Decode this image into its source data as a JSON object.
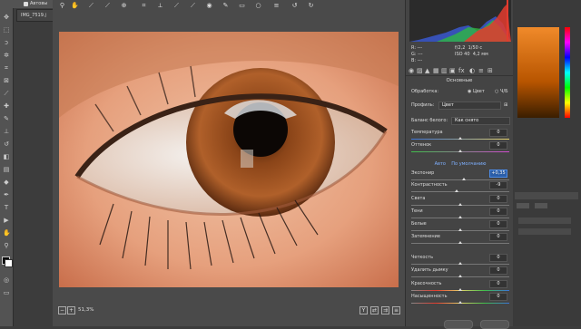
{
  "app": {
    "option_label": "Автовы",
    "doc_tab": "IMG_7519.j"
  },
  "camera_raw": {
    "meta": {
      "r_label": "R:",
      "g_label": "G:",
      "b_label": "B:",
      "dash": "---",
      "aperture": "f/2,2",
      "shutter": "1/50 с",
      "iso": "ISO 40",
      "focal": "4,2 мм"
    },
    "section_title": "Основные",
    "processing_label": "Обработка:",
    "processing_color": "Цвет",
    "processing_bw": "Ч/Б",
    "profile_label": "Профиль:",
    "profile_value": "Цвет",
    "wb_label": "Баланс белого:",
    "wb_value": "Как снято",
    "auto_link": "Авто",
    "default_link": "По умолчанию",
    "zoom_level": "51,3%",
    "sliders": [
      {
        "label": "Температура",
        "value": "0",
        "pos": 0.5
      },
      {
        "label": "Оттенок",
        "value": "0",
        "pos": 0.5
      },
      {
        "label": "Экспонир",
        "value": "+0,35",
        "pos": 0.54,
        "active": true
      },
      {
        "label": "Контрастность",
        "value": "-9",
        "pos": 0.46
      },
      {
        "label": "Света",
        "value": "0",
        "pos": 0.5
      },
      {
        "label": "Тени",
        "value": "0",
        "pos": 0.5
      },
      {
        "label": "Белые",
        "value": "0",
        "pos": 0.5
      },
      {
        "label": "Затемнение",
        "value": "0",
        "pos": 0.5
      },
      {
        "label": "Четкость",
        "value": "0",
        "pos": 0.5
      },
      {
        "label": "Удалить дымку",
        "value": "0",
        "pos": 0.5
      },
      {
        "label": "Красочность",
        "value": "0",
        "pos": 0.5
      },
      {
        "label": "Насыщенность",
        "value": "0",
        "pos": 0.5
      }
    ]
  },
  "colors": {
    "accent": "#2b5ea8",
    "iris": "#8a4418",
    "skin": "#e3a27f"
  }
}
